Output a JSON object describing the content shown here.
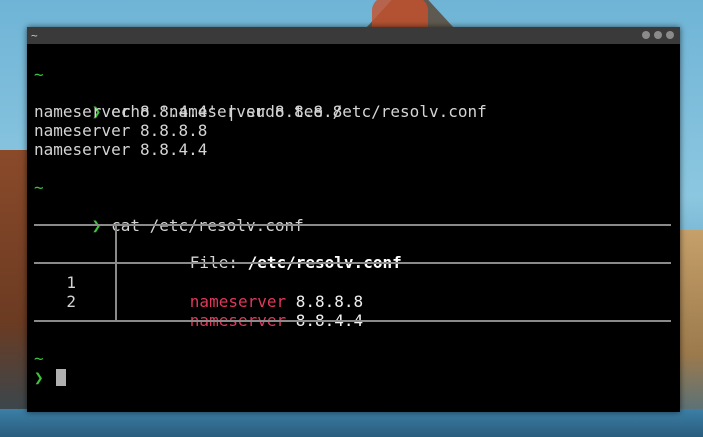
{
  "window": {
    "title": "~"
  },
  "prompt": {
    "tilde": "~",
    "arrow": "❯"
  },
  "block1": {
    "cmd_line1": "echo 'nameserver 8.8.8.8",
    "cmd_line2": "nameserver 8.8.4.4' | sudo tee /etc/resolv.conf",
    "out1": "nameserver 8.8.8.8",
    "out2": "nameserver 8.8.4.4"
  },
  "block2": {
    "cmd": "cat /etc/resolv.conf",
    "file_label": "File: ",
    "file_name": "/etc/resolv.conf",
    "rows": [
      {
        "num": "1",
        "key": "nameserver",
        "val": " 8.8.8.8"
      },
      {
        "num": "2",
        "key": "nameserver",
        "val": " 8.8.4.4"
      }
    ]
  }
}
